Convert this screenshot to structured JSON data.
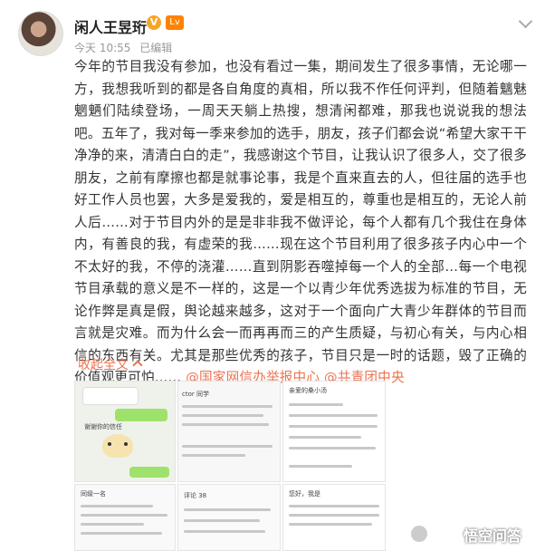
{
  "header": {
    "name": "闲人王昱珩",
    "verified_badge": "V",
    "level_badge": "Lv",
    "time": "今天 10:55",
    "edited": "已编辑"
  },
  "post": {
    "body": "今年的节目我没有参加，也没有看过一集，期间发生了很多事情，无论哪一方，我想我听到的都是各自角度的真相，所以我不作任何评判，但随着魑魅魍魉们陆续登场，一周天天躺上热搜，想清闲都难，那我也说说我的想法吧。五年了，我对每一季来参加的选手，朋友，孩子们都会说“希望大家干干净净的来，清清白白的走”，我感谢这个节目，让我认识了很多人，交了很多朋友，之前有摩擦也都是就事论事，我是个直来直去的人，但往届的选手也好工作人员也罢，大多是爱我的，爱是相互的，尊重也是相互的，无论人前人后……对于节目内外的是是非非我不做评论，每个人都有几个我住在身体内，有善良的我，有虚荣的我……现在这个节目利用了很多孩子内心中一个不太好的我，不停的浇灌……直到阴影吞噬掉每一个人的全部…每一个电视节目承载的意义是不一样的，这是一个以青少年优秀选拔为标准的节目，无论作弊是真是假，舆论越来越多，这对于一个面向广大青少年群体的节目而言就是灾难。而为什么会一而再再而三的产生质疑，与初心有关，与内心相信的东西有关。尤其是那些优秀的孩子，节目只是一时的话题，毁了正确的价值观更可怕……",
    "mention_1": "@国家网信办举报中心",
    "mention_2": "@共青团中央",
    "collapse_label": "收起全文"
  },
  "images": {
    "t1_text": "谢谢你的信任",
    "t2_text": "ctor 同学",
    "t3_text": "亲爱的桑小汤",
    "t4_text": "同级一名",
    "t5_text": "评论 38",
    "t6_text": "您好，我是"
  },
  "watermark": "悟空问答",
  "colors": {
    "accent": "#eb7350",
    "text": "#333333",
    "meta": "#999999"
  }
}
